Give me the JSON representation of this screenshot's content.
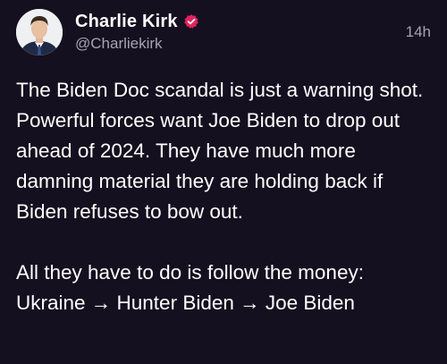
{
  "post": {
    "author": {
      "display_name": "Charlie Kirk",
      "handle": "@Charliekirk",
      "verified": true,
      "verified_color": "#e0245e"
    },
    "timestamp": "14h",
    "paragraphs": [
      "The Biden Doc scandal is just a warning shot. Powerful forces want Joe Biden to drop out ahead of 2024. They have much more damning material they are holding back if Biden refuses to bow out.",
      "All they have to do is follow the money: Ukraine → Hunter Biden → Joe Biden"
    ]
  },
  "theme": {
    "background": "#15101f",
    "text": "#ffffff",
    "secondary_text": "#a8a3b3"
  },
  "icons": {
    "avatar": "profile-photo",
    "verified": "verified-badge-icon"
  }
}
